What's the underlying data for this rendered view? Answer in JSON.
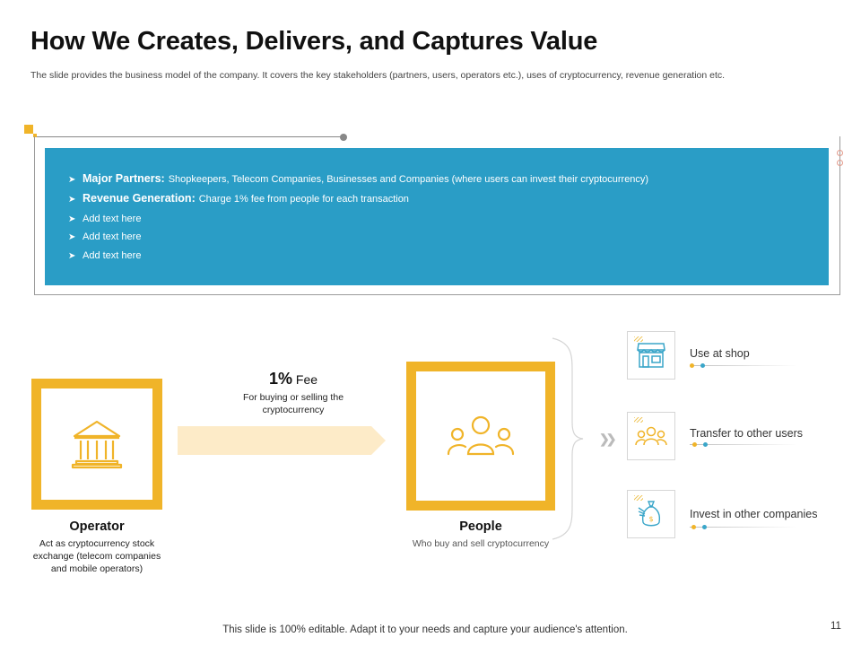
{
  "header": {
    "title": "How We Creates, Delivers, and Captures Value",
    "subtitle": "The slide provides the business model of the company. It covers the key stakeholders (partners, users, operators etc.), uses of cryptocurrency, revenue generation etc."
  },
  "info_box": {
    "bullets": [
      {
        "bold": "Major Partners:",
        "text": "Shopkeepers, Telecom Companies, Businesses and Companies (where users can invest their cryptocurrency)"
      },
      {
        "bold": "Revenue Generation:",
        "text": "Charge 1% fee from people for each transaction"
      },
      {
        "bold": "",
        "text": "Add text here"
      },
      {
        "bold": "",
        "text": "Add text here"
      },
      {
        "bold": "",
        "text": "Add text here"
      }
    ]
  },
  "operator": {
    "title": "Operator",
    "description": "Act as cryptocurrency stock exchange (telecom companies and mobile operators)",
    "icon": "bank-icon"
  },
  "fee": {
    "percent": "1%",
    "label": "Fee",
    "description": "For buying or selling the cryptocurrency"
  },
  "people": {
    "title": "People",
    "description": "Who buy and sell cryptocurrency",
    "icon": "users-icon"
  },
  "uses": [
    {
      "label": "Use at shop",
      "icon": "shop-icon"
    },
    {
      "label": "Transfer to other users",
      "icon": "users-group-icon"
    },
    {
      "label": "Invest in other companies",
      "icon": "money-bag-icon"
    }
  ],
  "footer": {
    "text": "This slide is 100% editable. Adapt it to your needs and capture your audience's attention.",
    "page_number": "11"
  },
  "colors": {
    "accent_yellow": "#f0b429",
    "box_blue": "#2a9dc6",
    "icon_teal": "#3aa6c9",
    "dot_orange": "#f0b429"
  }
}
